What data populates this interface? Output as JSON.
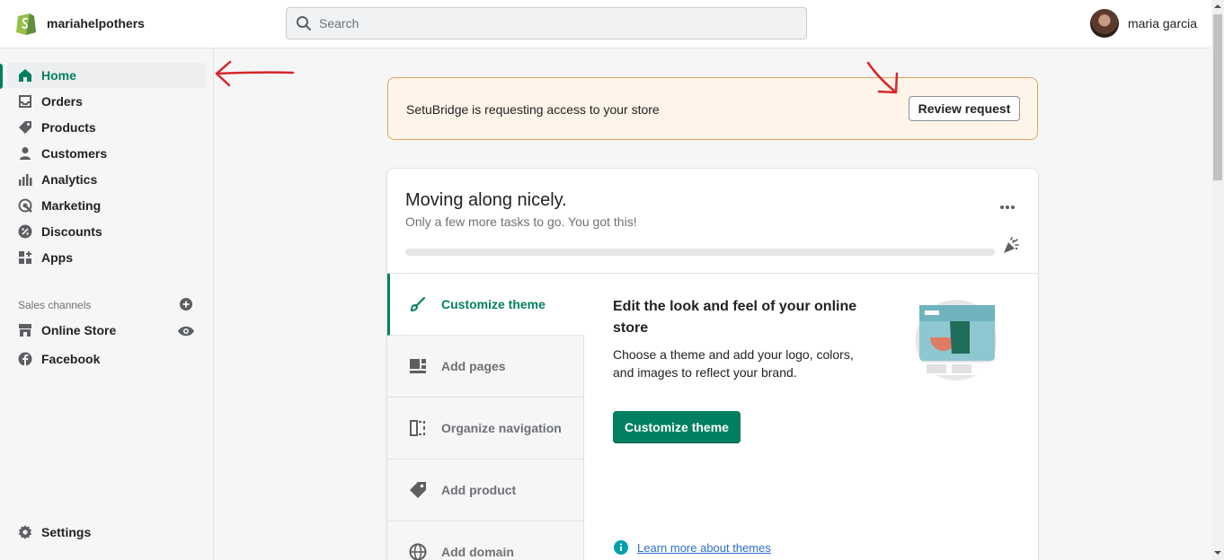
{
  "topbar": {
    "store_name": "mariahelpothers",
    "search_placeholder": "Search",
    "user_name": "maria garcia"
  },
  "sidebar": {
    "items": [
      {
        "label": "Home",
        "icon": "home-icon"
      },
      {
        "label": "Orders",
        "icon": "orders-icon"
      },
      {
        "label": "Products",
        "icon": "tag-icon"
      },
      {
        "label": "Customers",
        "icon": "person-icon"
      },
      {
        "label": "Analytics",
        "icon": "bar-chart-icon"
      },
      {
        "label": "Marketing",
        "icon": "target-icon"
      },
      {
        "label": "Discounts",
        "icon": "discount-icon"
      },
      {
        "label": "Apps",
        "icon": "apps-icon"
      }
    ],
    "sales_channels_label": "Sales channels",
    "channels": [
      {
        "label": "Online Store",
        "icon": "store-icon"
      },
      {
        "label": "Facebook",
        "icon": "facebook-icon"
      }
    ],
    "settings_label": "Settings"
  },
  "banner": {
    "text": "SetuBridge is requesting access to your store",
    "button_label": "Review request"
  },
  "setup_card": {
    "title": "Moving along nicely.",
    "subtitle": "Only a few more tasks to go. You got this!",
    "progress_fraction": 0,
    "tasks": [
      {
        "label": "Customize theme",
        "icon": "brush-icon"
      },
      {
        "label": "Add pages",
        "icon": "pages-icon"
      },
      {
        "label": "Organize navigation",
        "icon": "navigation-icon"
      },
      {
        "label": "Add product",
        "icon": "tag-icon"
      },
      {
        "label": "Add domain",
        "icon": "globe-icon"
      }
    ],
    "detail": {
      "title": "Edit the look and feel of your online store",
      "text": "Choose a theme and add your logo, colors, and images to reflect your brand.",
      "button_label": "Customize theme",
      "learn_more": "Learn more about themes"
    }
  },
  "colors": {
    "accent": "#008060",
    "banner_bg": "#fff4e9",
    "banner_border": "#e4a361",
    "annotation": "#d8262c",
    "link": "#2c6ecb"
  }
}
